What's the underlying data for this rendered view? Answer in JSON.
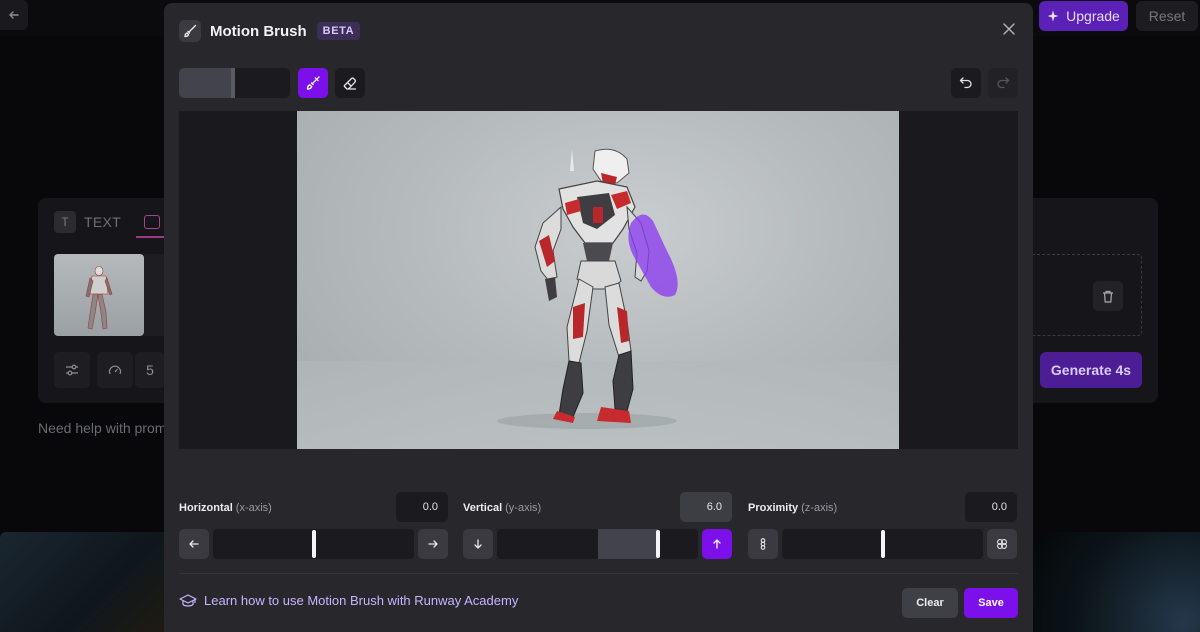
{
  "background": {
    "back_icon": "arrow-left-icon",
    "upgrade_label": "Upgrade",
    "upgrade_icon": "sparkle-icon",
    "reset_label": "Reset",
    "tab_text_label": "TEXT",
    "tab_text_icon_letter": "T",
    "duration_value": "5",
    "generate_label": "Generate 4s",
    "help_text": "Need help with promp"
  },
  "modal": {
    "title": "Motion Brush",
    "badge": "BETA",
    "close_icon": "close-icon",
    "brush_size_fraction": 0.5,
    "tools": [
      {
        "name": "brush",
        "icon": "brush-icon",
        "active": true
      },
      {
        "name": "eraser",
        "icon": "eraser-icon",
        "active": false
      }
    ],
    "history": [
      {
        "name": "undo",
        "icon": "undo-icon",
        "enabled": true
      },
      {
        "name": "redo",
        "icon": "redo-icon",
        "enabled": false
      }
    ],
    "axes": [
      {
        "label": "Horizontal",
        "sub": "(x-axis)",
        "value": "0.0",
        "numeric": 0.0,
        "min_icon": "arrow-left-icon",
        "max_icon": "arrow-right-icon",
        "active_button": "none"
      },
      {
        "label": "Vertical",
        "sub": "(y-axis)",
        "value": "6.0",
        "numeric": 6.0,
        "min_icon": "arrow-down-icon",
        "max_icon": "arrow-up-icon",
        "active_button": "max"
      },
      {
        "label": "Proximity",
        "sub": "(z-axis)",
        "value": "0.0",
        "numeric": 0.0,
        "min_icon": "proximity-far-icon",
        "max_icon": "proximity-near-icon",
        "active_button": "none"
      }
    ],
    "academy_text": "Learn how to use Motion Brush with Runway Academy",
    "academy_icon": "graduation-cap-icon",
    "clear_label": "Clear",
    "save_label": "Save"
  },
  "colors": {
    "accent": "#7c10ea",
    "mask": "#8b3cf0",
    "modal_bg": "#27272c"
  }
}
